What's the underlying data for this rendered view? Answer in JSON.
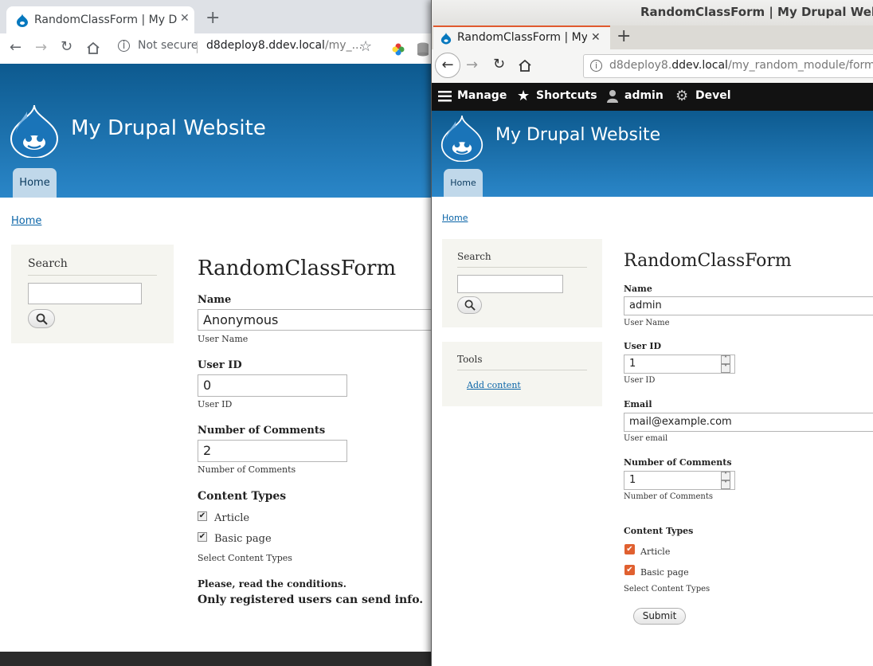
{
  "left_window": {
    "browser": {
      "tab_title": "RandomClassForm | My Dr",
      "security_label": "Not secure",
      "url_domain": "d8deploy8.ddev.local",
      "url_path": "/my_..."
    },
    "site_name": "My Drupal Website",
    "nav_home": "Home",
    "breadcrumb_home": "Home",
    "search_block_title": "Search",
    "form": {
      "title": "RandomClassForm",
      "name_label": "Name",
      "name_value": "Anonymous",
      "name_desc": "User Name",
      "uid_label": "User ID",
      "uid_value": "0",
      "uid_desc": "User ID",
      "comments_label": "Number of Comments",
      "comments_value": "2",
      "comments_desc": "Number of Comments",
      "content_types_label": "Content Types",
      "option_article": "Article",
      "option_basic_page": "Basic page",
      "content_types_desc": "Select Content Types",
      "notice_line1": "Please, read the conditions.",
      "notice_line2": "Only registered users can send info."
    }
  },
  "right_window": {
    "window_title": "RandomClassForm | My Drupal Website -",
    "browser": {
      "tab_title": "RandomClassForm | My D",
      "url_domain_start": "d8deploy8.",
      "url_domain_main": "ddev.local",
      "url_path": "/my_random_module/form"
    },
    "admin_toolbar": {
      "manage": "Manage",
      "shortcuts": "Shortcuts",
      "admin": "admin",
      "devel": "Devel"
    },
    "site_name": "My Drupal Website",
    "nav_home": "Home",
    "breadcrumb_home": "Home",
    "search_block_title": "Search",
    "tools_block_title": "Tools",
    "tools_add_content": "Add content",
    "form": {
      "title": "RandomClassForm",
      "name_label": "Name",
      "name_value": "admin",
      "name_desc": "User Name",
      "uid_label": "User ID",
      "uid_value": "1",
      "uid_desc": "User ID",
      "email_label": "Email",
      "email_value": "mail@example.com",
      "email_desc": "User email",
      "comments_label": "Number of Comments",
      "comments_value": "1",
      "comments_desc": "Number of Comments",
      "content_types_label": "Content Types",
      "option_article": "Article",
      "option_basic_page": "Basic page",
      "content_types_desc": "Select Content Types",
      "submit_label": "Submit"
    }
  },
  "colors": {
    "header_top": "#0d5a8f",
    "header_bottom": "#2a86c8",
    "link": "#0b65a8",
    "checkbox_accent": "#e06030",
    "admin_bar": "#121212"
  }
}
